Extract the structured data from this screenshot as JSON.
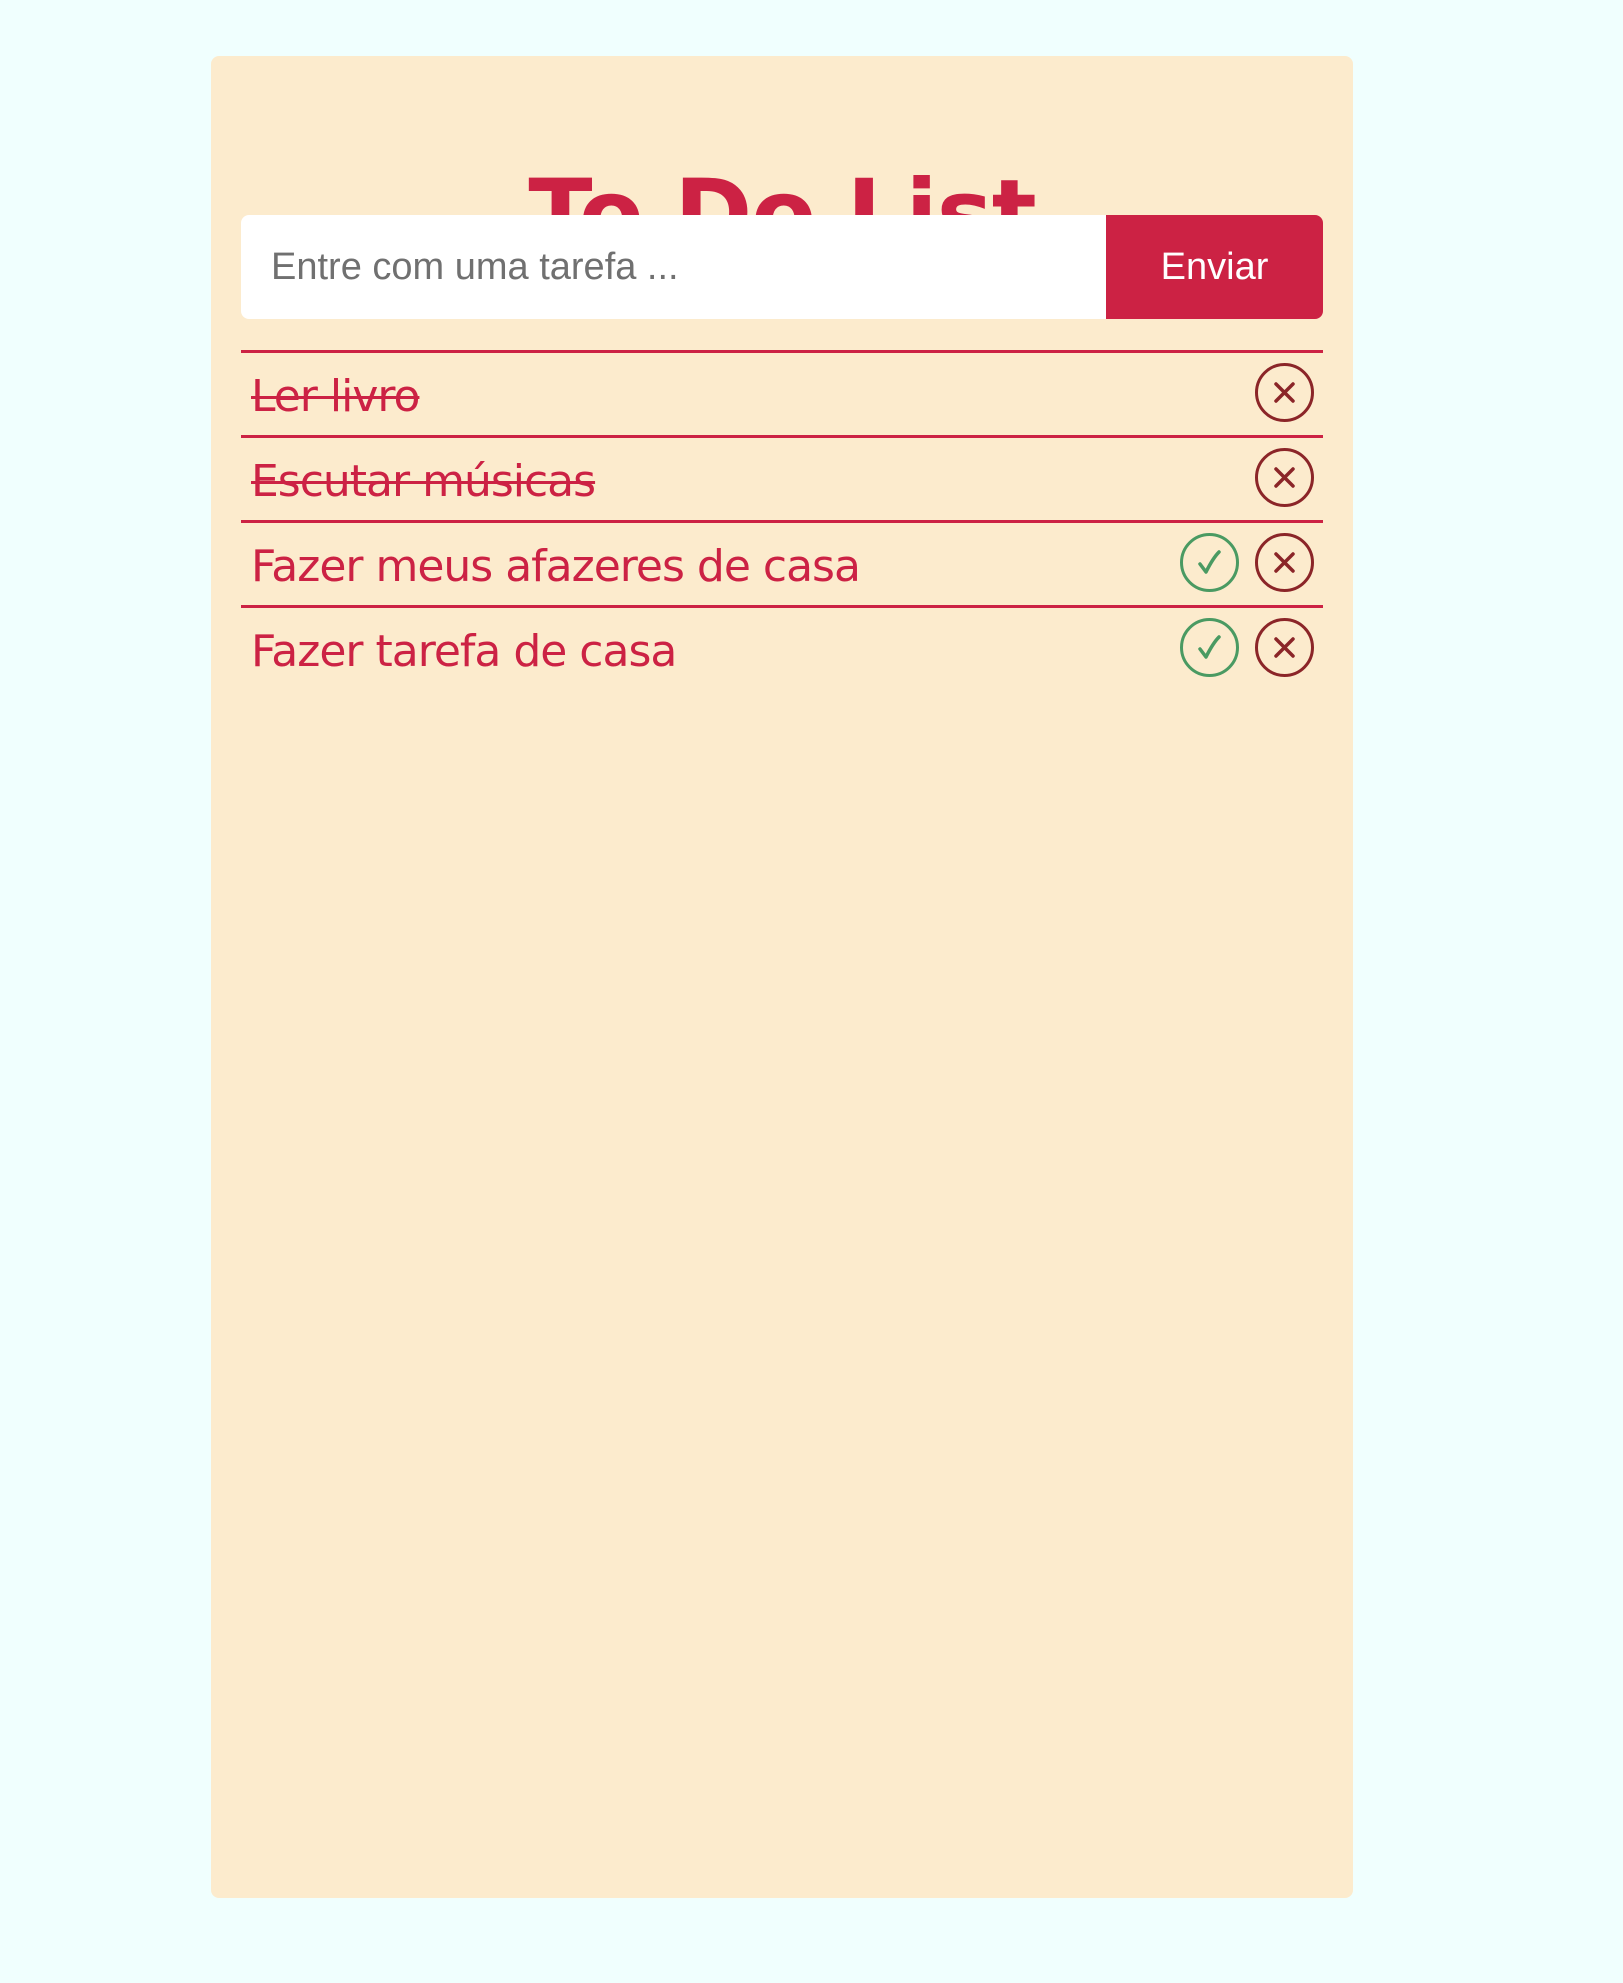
{
  "app": {
    "title": "To Do List"
  },
  "form": {
    "placeholder": "Entre com uma tarefa ...",
    "value": "",
    "submit_label": "Enviar"
  },
  "tasks": [
    {
      "text": "Ler livro",
      "done": true
    },
    {
      "text": "Escutar músicas",
      "done": true
    },
    {
      "text": "Fazer meus afazeres de casa",
      "done": false
    },
    {
      "text": "Fazer tarefa de casa",
      "done": false
    }
  ],
  "icons": {
    "complete": "check-circle-icon",
    "delete": "x-circle-icon"
  },
  "colors": {
    "page_background": "#f0fffe",
    "card_background": "#fcebcd",
    "accent": "#cc2244",
    "complete_icon": "#4a9a62",
    "delete_icon": "#8b2528"
  }
}
